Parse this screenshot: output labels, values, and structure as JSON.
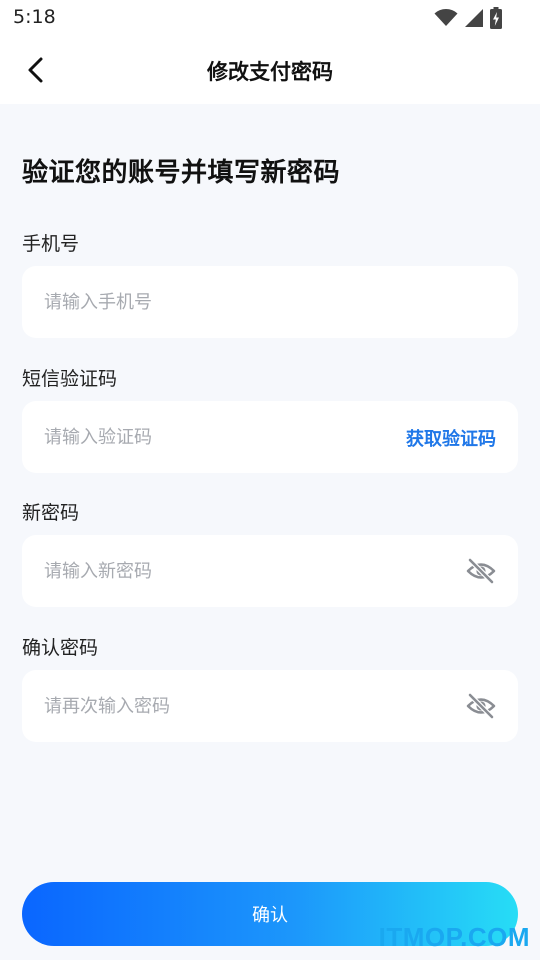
{
  "status_bar": {
    "time": "5:18",
    "icons": [
      "wifi-icon",
      "signal-icon",
      "battery-charging-icon"
    ]
  },
  "header": {
    "back_icon": "chevron-left-icon",
    "title": "修改支付密码"
  },
  "form": {
    "heading": "验证您的账号并填写新密码",
    "phone": {
      "label": "手机号",
      "placeholder": "请输入手机号",
      "value": ""
    },
    "sms": {
      "label": "短信验证码",
      "placeholder": "请输入验证码",
      "value": "",
      "action": "获取验证码"
    },
    "new_password": {
      "label": "新密码",
      "placeholder": "请输入新密码",
      "value": "",
      "toggle_icon": "eye-off-icon"
    },
    "confirm_password": {
      "label": "确认密码",
      "placeholder": "请再次输入密码",
      "value": "",
      "toggle_icon": "eye-off-icon"
    }
  },
  "confirm_button": {
    "label": "确认"
  },
  "watermark": "ITMOP.COM",
  "colors": {
    "accent": "#1f77e8",
    "gradient_start": "#0a66ff",
    "gradient_end": "#27ddf6",
    "background": "#f6f8fc",
    "placeholder": "#a7aab0"
  }
}
